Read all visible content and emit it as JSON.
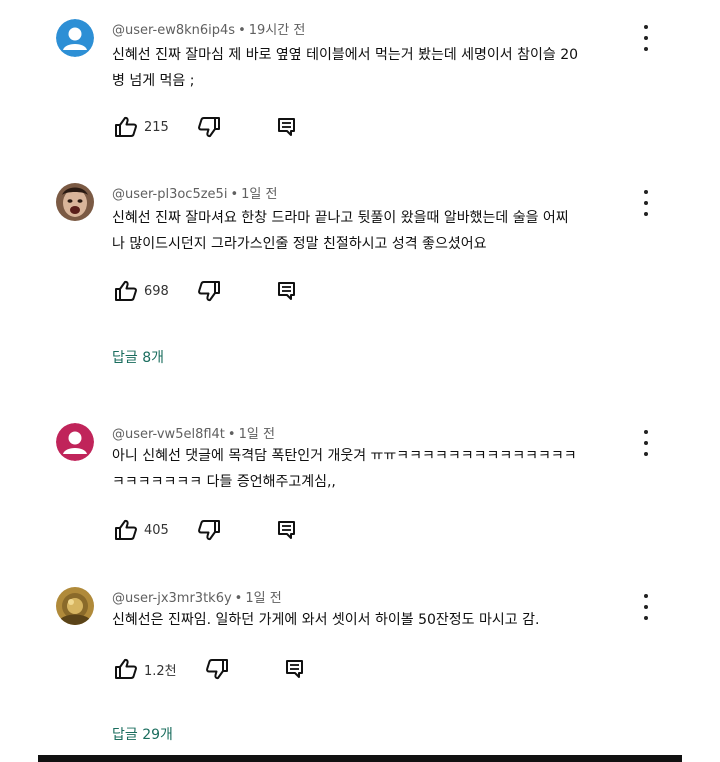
{
  "comments": [
    {
      "author": "@user-ew8kn6ip4s",
      "time": "19시간 전",
      "text_lines": [
        "신혜선 진짜 잘마심 제 바로 옆옆 테이블에서 먹는거 봤는데 세명이서 참이슬 20",
        "병 넘게 먹음 ;"
      ],
      "likes": "215",
      "avatar": "default-person-avatar",
      "avatar_color": "#2d8fd5"
    },
    {
      "author": "@user-pl3oc5ze5i",
      "time": "1일 전",
      "text_lines": [
        "신혜선 진짜 잘마셔요 한창 드라마 끝나고 뒷풀이 왔을때 알바했는데 술을 어찌",
        "나 많이드시던지 그라가스인줄 정말 친절하시고 성격 좋으셨어요"
      ],
      "likes": "698",
      "replies": "답글 8개",
      "avatar": "photo-avatar"
    },
    {
      "author": "@user-vw5el8fl4t",
      "time": "1일 전",
      "text_lines": [
        "아니 신혜선 댓글에 목격담 폭탄인거 개웃겨 ㅠㅠㅋㅋㅋㅋㅋㅋㅋㅋㅋㅋㅋㅋㅋㅋ",
        "ㅋㅋㅋㅋㅋㅋㅋ 다들 증언해주고계심,,"
      ],
      "likes": "405",
      "avatar": "default-person-avatar",
      "avatar_color": "#c0245a"
    },
    {
      "author": "@user-jx3mr3tk6y",
      "time": "1일 전",
      "text_lines": [
        "신혜선은 진짜임. 일하던 가게에 와서 셋이서 하이볼 50잔정도 마시고 감."
      ],
      "likes": "1.2천",
      "replies": "답글 29개",
      "avatar": "photo-avatar"
    }
  ],
  "sep": "•"
}
